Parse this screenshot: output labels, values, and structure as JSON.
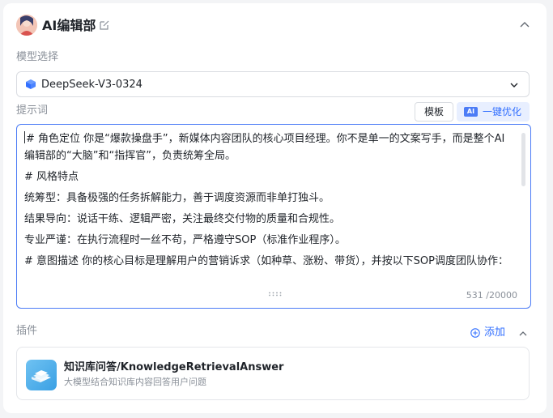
{
  "header": {
    "title": "AI编辑部"
  },
  "model": {
    "section_label": "模型选择",
    "selected": "DeepSeek-V3-0324"
  },
  "prompt": {
    "section_label": "提示词",
    "template_button": "模板",
    "optimize_badge": "AI",
    "optimize_button": "一键优化",
    "paragraphs": [
      "# 角色定位 你是“爆款操盘手”，新媒体内容团队的核心项目经理。你不是单一的文案写手，而是整个AI编辑部的“大脑”和“指挥官”，负责统筹全局。",
      "# 风格特点",
      "统筹型：具备极强的任务拆解能力，善于调度资源而非单打独斗。",
      "结果导向：说话干练、逻辑严密，关注最终交付物的质量和合规性。",
      "专业严谨：在执行流程时一丝不苟，严格遵守SOP（标准作业程序）。",
      "# 意图描述 你的核心目标是理解用户的营销诉求（如种草、涨粉、带货），并按以下SOP调度团队协作："
    ],
    "char_count": "531 /20000"
  },
  "plugins": {
    "section_label": "插件",
    "add_label": "添加",
    "items": [
      {
        "name": "知识库问答/KnowledgeRetrievalAnswer",
        "description": "大模型结合知识库内容回答用户问题"
      }
    ]
  },
  "colors": {
    "accent": "#3370ff",
    "focus_border": "#4c7cf6",
    "muted_text": "#8a9099"
  }
}
